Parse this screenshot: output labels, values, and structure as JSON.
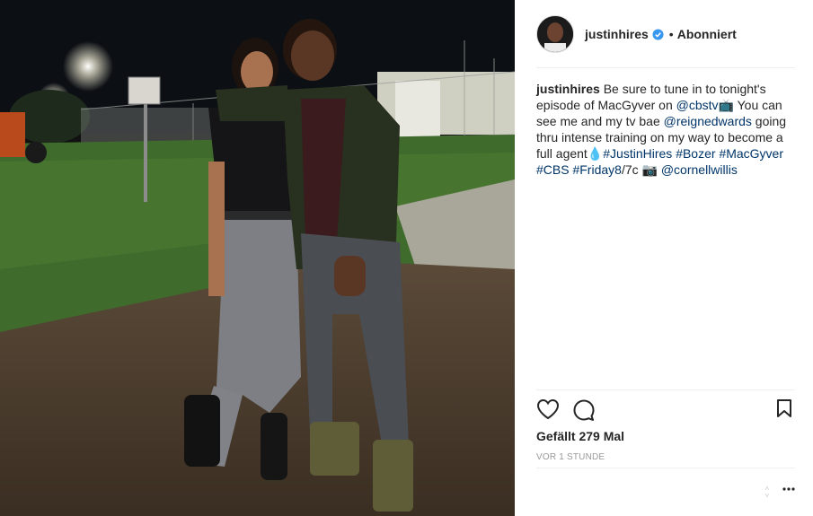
{
  "user": {
    "username": "justinhires",
    "follow_status": "Abonniert",
    "separator": "•"
  },
  "caption": {
    "username": "justinhires",
    "t1": "Be sure to tune in to tonight's episode of MacGyver on",
    "m1": "@cbstv",
    "e1": "📺",
    "t2": "You can see me and my tv bae",
    "m2": "@reignedwards",
    "t3": "going thru intense training on my way to become a full agent",
    "e2": "💧",
    "h1": "#JustinHires",
    "h2": "#Bozer",
    "h3": "#MacGyver",
    "h4": "#CBS",
    "h5": "#Friday8",
    "t4": "/7c",
    "e3": "📷",
    "m3": "@cornellwillis"
  },
  "stats": {
    "likes": "Gefällt 279 Mal",
    "time": "VOR 1 STUNDE"
  },
  "icons": {
    "like": "heart-icon",
    "comment": "comment-icon",
    "save": "bookmark-icon",
    "more": "more-options-icon",
    "verified": "verified-badge-icon"
  },
  "colors": {
    "link": "#003569",
    "verified": "#3897f0",
    "muted": "#999999",
    "divider": "#efefef"
  }
}
